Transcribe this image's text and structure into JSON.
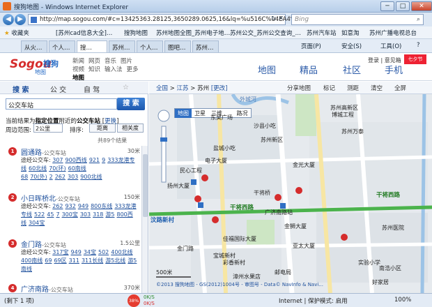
{
  "window": {
    "title": "搜狗地图 - Windows Internet Explorer",
    "min": "─",
    "max": "□",
    "close": "✕"
  },
  "address": {
    "url": "http://map.sogou.com/#c=13425363.28125,3650289.0625,16&lq=%u516C%u4EA4%u8F66",
    "search_placeholder": "Bing"
  },
  "favbar": {
    "favorites": "收藏夹",
    "items": [
      "[苏州cad信息大全]…",
      "搜狗地图",
      "苏州地图全图_苏州电子地…",
      "苏州公交_苏州公交查询_…",
      "苏州汽车站",
      "如意淘",
      "苏州广播电视总台"
    ]
  },
  "tabs": [
    "从火…",
    "个人…",
    "搜…",
    "苏州…",
    "个人…",
    "图吧…",
    "苏州…"
  ],
  "toolbar": [
    "页面(P)",
    "安全(S)",
    "工具(O)",
    "?"
  ],
  "header": {
    "logo": "Sogou",
    "logo_cn": "搜狗",
    "logo_sub": "地图",
    "links_row1": [
      "新闻",
      "网页",
      "音乐",
      "图片"
    ],
    "links_row2": [
      "视频",
      "知识",
      "输入法",
      "更多"
    ],
    "links_row3": [
      "地图"
    ],
    "bignav": [
      "地图",
      "精品",
      "社区",
      "手机"
    ],
    "user": "登录 | 意见箱",
    "ad": "七夕节"
  },
  "left": {
    "tabs": [
      "搜 索",
      "公 交",
      "自 驾",
      "☆"
    ],
    "query": "公交车站",
    "search_btn": "搜 索",
    "hint_prefix": "当前结果为",
    "hint_bold": "指定位置",
    "hint_mid": "附近的",
    "hint_bold2": "公交车站",
    "hint_link": "更换",
    "range_label": "周边范围:",
    "range_value": "2公里",
    "sort_label": "排序:",
    "sort_dist": "距离",
    "sort_rel": "相关度",
    "count": "共89个结果",
    "results": [
      {
        "pin": "1",
        "name": "圆通路",
        "type": "-公交车站",
        "dist": "30米",
        "lines": [
          "途经公交车:",
          "307",
          "900西线",
          "921",
          "9",
          "333龙港专线",
          "60北线",
          "70(环)",
          "60南线",
          "68",
          "70(外)",
          "2",
          "262",
          "303",
          "900北线"
        ]
      },
      {
        "pin": "2",
        "name": "小日晖桥北",
        "type": "-公交车站",
        "dist": "150米",
        "lines": [
          "途经公交车:",
          "262",
          "932",
          "949",
          "800东线",
          "333龙港专线",
          "522",
          "45",
          "7",
          "300宝",
          "303",
          "318",
          "游5",
          "800西线",
          "304宝"
        ]
      },
      {
        "pin": "3",
        "name": "金门路",
        "type": "-公交车站",
        "dist": "1.5公里",
        "lines": [
          "途经公交车:",
          "317宝",
          "949",
          "34宝",
          "502",
          "400北线",
          "400南线",
          "69",
          "69区",
          "311",
          "311长线",
          "游5北线",
          "游5南线"
        ]
      },
      {
        "pin": "4",
        "name": "广济南路",
        "type": "-公交车站",
        "dist": "370米",
        "lines": []
      }
    ]
  },
  "map": {
    "crumb_home": "全国",
    "crumb_prov": "江苏",
    "crumb_city": "苏州",
    "crumb_change": "[更改]",
    "tools": [
      "分享地图",
      "标记",
      "测距",
      "清空",
      "全屏"
    ],
    "types": [
      "地图",
      "卫星",
      "三维"
    ],
    "type_more": "路况",
    "scale": "500米",
    "copyright": "©2013 搜狗地图 - GS(2012)1004号 - 审图号 - Data© NavInfo & Navi...",
    "labels": [
      "外城河",
      "苏州高新区",
      "博城工程",
      "东吴广场",
      "沙县小吃",
      "苏州万泰",
      "苏州新区",
      "盐城小吃",
      "金光大厦",
      "民心工程",
      "电子大厦",
      "干将西路",
      "干将西路",
      "干将桥",
      "扬州大厦",
      "汶路新村",
      "广济南路站",
      "金狮大厦",
      "佳福国际大厦",
      "亚太大厦",
      "宝城新村",
      "彩香新村",
      "实验小学",
      "金门路",
      "苏州医院",
      "邮电局",
      "漳州水果店",
      "南浩小区",
      "好家居"
    ]
  },
  "status": {
    "left": "(剩下 1 项)",
    "rec": "38%",
    "up": "0K/S",
    "down": "0K/S",
    "zone": "Internet | 保护模式: 启用",
    "zoom": "100%"
  }
}
